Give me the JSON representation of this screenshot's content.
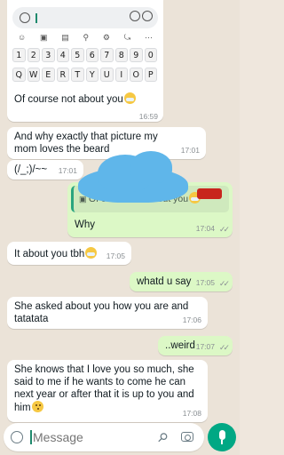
{
  "keyboard": {
    "row1": [
      "1",
      "2",
      "3",
      "4",
      "5",
      "6",
      "7",
      "8",
      "9",
      "0"
    ],
    "row2": [
      "Q",
      "W",
      "E",
      "R",
      "T",
      "Y",
      "U",
      "I",
      "O",
      "P"
    ]
  },
  "messages": [
    {
      "id": "m1",
      "dir": "in",
      "text": "Of course not about you",
      "time": "16:59"
    },
    {
      "id": "m2",
      "dir": "in",
      "text": "And why exactly that picture my mom loves the beard",
      "time": "17:01"
    },
    {
      "id": "m3",
      "dir": "in",
      "text": "(/_;)/~~",
      "time": "17:01"
    },
    {
      "id": "m4",
      "dir": "out",
      "quote": "Of course not about you",
      "text": "Why",
      "time": "17:04"
    },
    {
      "id": "m5",
      "dir": "in",
      "text": "It about you tbh",
      "time": "17:05"
    },
    {
      "id": "m6",
      "dir": "out",
      "text": "whatd u say",
      "time": "17:05"
    },
    {
      "id": "m7",
      "dir": "in",
      "text": "She asked about you how you are and tatatata",
      "time": "17:06"
    },
    {
      "id": "m8",
      "dir": "out",
      "text": "..weird",
      "time": "17:07"
    },
    {
      "id": "m9",
      "dir": "in",
      "text": "She knows that I love you so much, she said to me if he wants to come he can next year or after that it is up to you and him",
      "time": "17:08"
    }
  ],
  "composer": {
    "placeholder": "Message"
  },
  "colors": {
    "incoming": "#ffffff",
    "outgoing": "#dcf8c6",
    "accent": "#00a884",
    "background": "#ebe3d8"
  }
}
